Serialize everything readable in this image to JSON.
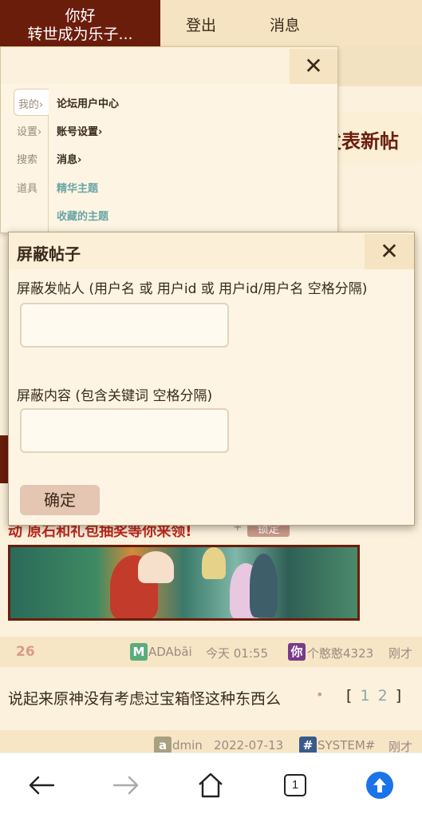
{
  "topbar": {
    "greeting": "你好",
    "username": "转世成为乐子...",
    "logout_label": "登出",
    "messages_label": "消息",
    "bg_color": "#6b1d0c"
  },
  "background": {
    "new_post_label": "发表新帖",
    "promo_title": "动 原石和礼包抽奖等你来领!",
    "promo_plus": "+",
    "lock_label": "锁定",
    "row1": {
      "count": "26",
      "author_badge": "M",
      "author": "ADAbāi",
      "time": "今天 01:55",
      "last_badge": "你",
      "last_user": "个憨憨4323",
      "last_time": "刚才"
    },
    "thread": {
      "title": "说起来原神没有考虑过宝箱怪这种东西么",
      "dot": "•",
      "pages_open": "[",
      "page1": "1",
      "page2": "2",
      "pages_close": "]"
    },
    "row2": {
      "author_badge": "a",
      "author": "dmin",
      "time": "2022-07-13",
      "last_badge": "#",
      "last_user": "SYSTEM#",
      "last_time": "刚才"
    }
  },
  "side_panel": {
    "close_icon": "close-icon",
    "categories": [
      "我的›",
      "设置›",
      "搜索",
      "道具"
    ],
    "links": [
      "论坛用户中心",
      "账号设置›",
      "消息›",
      "精华主题",
      "收藏的主题"
    ]
  },
  "modal": {
    "title": "屏蔽帖子",
    "poster_label": "屏蔽发帖人 (用户名 或 用户id 或 用户id/用户名 空格分隔)",
    "poster_value": "",
    "content_label": "屏蔽内容 (包含关键词 空格分隔)",
    "content_value": "",
    "confirm_label": "确定"
  },
  "bottom_nav": {
    "tab_count": "1",
    "accent": "#1a73e8"
  }
}
